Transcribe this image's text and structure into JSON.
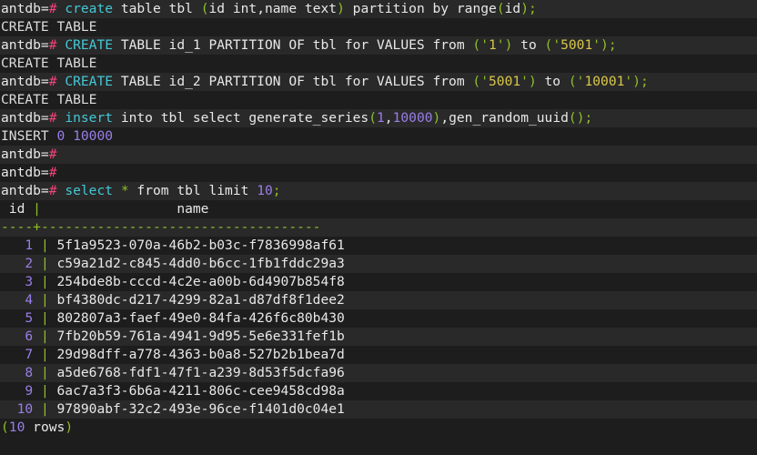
{
  "terminal": {
    "title": "antdb psql session",
    "prompt": "antdb=",
    "prompt_symbol": "#",
    "colors": {
      "background": "#1d1d1d",
      "background_alt": "#292929",
      "foreground": "#e8e8e8",
      "keyword": "#43c8d6",
      "punctuation": "#8fc029",
      "string": "#d9c84a",
      "number": "#9a7fe8",
      "prompt_hash": "#f0447a"
    },
    "lines": [
      {
        "id": "cmd-create-table",
        "type": "command",
        "text": "antdb=# create table tbl (id int,name text) partition by range(id);",
        "tokens": [
          {
            "t": "antdb=",
            "c": "c-prompt"
          },
          {
            "t": "#",
            "c": "c-hash"
          },
          {
            "t": " ",
            "c": "c-white"
          },
          {
            "t": "create",
            "c": "c-kw"
          },
          {
            "t": " table tbl ",
            "c": "c-white"
          },
          {
            "t": "(",
            "c": "c-punct"
          },
          {
            "t": "id int,name text",
            "c": "c-white"
          },
          {
            "t": ")",
            "c": "c-punct"
          },
          {
            "t": " partition by range",
            "c": "c-white"
          },
          {
            "t": "(",
            "c": "c-punct"
          },
          {
            "t": "id",
            "c": "c-white"
          },
          {
            "t": ")",
            "c": "c-punct"
          },
          {
            "t": ";",
            "c": "c-punct"
          }
        ]
      },
      {
        "id": "out-create-table-1",
        "type": "output",
        "text": "CREATE TABLE",
        "tokens": [
          {
            "t": "CREATE TABLE",
            "c": "c-out"
          }
        ]
      },
      {
        "id": "cmd-create-partition-id1",
        "type": "command",
        "text": "antdb=# CREATE TABLE id_1 PARTITION OF tbl for VALUES from ('1') to ('5001');",
        "tokens": [
          {
            "t": "antdb=",
            "c": "c-prompt"
          },
          {
            "t": "#",
            "c": "c-hash"
          },
          {
            "t": " ",
            "c": "c-white"
          },
          {
            "t": "CREATE",
            "c": "c-kw"
          },
          {
            "t": " TABLE id_1 PARTITION OF tbl for VALUES from ",
            "c": "c-white"
          },
          {
            "t": "('",
            "c": "c-punct"
          },
          {
            "t": "1",
            "c": "c-str"
          },
          {
            "t": "')",
            "c": "c-punct"
          },
          {
            "t": " to ",
            "c": "c-white"
          },
          {
            "t": "('",
            "c": "c-punct"
          },
          {
            "t": "5001",
            "c": "c-str"
          },
          {
            "t": "')",
            "c": "c-punct"
          },
          {
            "t": ";",
            "c": "c-punct"
          }
        ]
      },
      {
        "id": "out-create-table-2",
        "type": "output",
        "text": "CREATE TABLE",
        "tokens": [
          {
            "t": "CREATE TABLE",
            "c": "c-out"
          }
        ]
      },
      {
        "id": "cmd-create-partition-id2",
        "type": "command",
        "text": "antdb=# CREATE TABLE id_2 PARTITION OF tbl for VALUES from ('5001') to ('10001');",
        "tokens": [
          {
            "t": "antdb=",
            "c": "c-prompt"
          },
          {
            "t": "#",
            "c": "c-hash"
          },
          {
            "t": " ",
            "c": "c-white"
          },
          {
            "t": "CREATE",
            "c": "c-kw"
          },
          {
            "t": " TABLE id_2 PARTITION OF tbl for VALUES from ",
            "c": "c-white"
          },
          {
            "t": "('",
            "c": "c-punct"
          },
          {
            "t": "5001",
            "c": "c-str"
          },
          {
            "t": "')",
            "c": "c-punct"
          },
          {
            "t": " to ",
            "c": "c-white"
          },
          {
            "t": "('",
            "c": "c-punct"
          },
          {
            "t": "10001",
            "c": "c-str"
          },
          {
            "t": "')",
            "c": "c-punct"
          },
          {
            "t": ";",
            "c": "c-punct"
          }
        ]
      },
      {
        "id": "out-create-table-3",
        "type": "output",
        "text": "CREATE TABLE",
        "tokens": [
          {
            "t": "CREATE TABLE",
            "c": "c-out"
          }
        ]
      },
      {
        "id": "cmd-insert",
        "type": "command",
        "text": "antdb=# insert into tbl select generate_series(1,10000),gen_random_uuid();",
        "tokens": [
          {
            "t": "antdb=",
            "c": "c-prompt"
          },
          {
            "t": "#",
            "c": "c-hash"
          },
          {
            "t": " ",
            "c": "c-white"
          },
          {
            "t": "insert",
            "c": "c-kw"
          },
          {
            "t": " into tbl select generate_series",
            "c": "c-white"
          },
          {
            "t": "(",
            "c": "c-punct"
          },
          {
            "t": "1",
            "c": "c-num"
          },
          {
            "t": ",",
            "c": "c-white"
          },
          {
            "t": "10000",
            "c": "c-num"
          },
          {
            "t": ")",
            "c": "c-punct"
          },
          {
            "t": ",gen_random_uuid",
            "c": "c-white"
          },
          {
            "t": "()",
            "c": "c-punct"
          },
          {
            "t": ";",
            "c": "c-punct"
          }
        ]
      },
      {
        "id": "out-insert",
        "type": "output",
        "text": "INSERT 0 10000",
        "tokens": [
          {
            "t": "INSERT ",
            "c": "c-out"
          },
          {
            "t": "0",
            "c": "c-num"
          },
          {
            "t": " ",
            "c": "c-white"
          },
          {
            "t": "10000",
            "c": "c-num"
          }
        ]
      },
      {
        "id": "prompt-empty-1",
        "type": "command",
        "text": "antdb=#",
        "tokens": [
          {
            "t": "antdb=",
            "c": "c-prompt"
          },
          {
            "t": "#",
            "c": "c-hash"
          }
        ]
      },
      {
        "id": "prompt-empty-2",
        "type": "command",
        "text": "antdb=#",
        "tokens": [
          {
            "t": "antdb=",
            "c": "c-prompt"
          },
          {
            "t": "#",
            "c": "c-hash"
          }
        ]
      },
      {
        "id": "cmd-select",
        "type": "command",
        "text": "antdb=# select * from tbl limit 10;",
        "tokens": [
          {
            "t": "antdb=",
            "c": "c-prompt"
          },
          {
            "t": "#",
            "c": "c-hash"
          },
          {
            "t": " ",
            "c": "c-white"
          },
          {
            "t": "select",
            "c": "c-kw"
          },
          {
            "t": " ",
            "c": "c-white"
          },
          {
            "t": "*",
            "c": "c-punct"
          },
          {
            "t": " from tbl limit ",
            "c": "c-white"
          },
          {
            "t": "10",
            "c": "c-num"
          },
          {
            "t": ";",
            "c": "c-punct"
          }
        ]
      },
      {
        "id": "table-header",
        "type": "table-header",
        "text": " id |                 name",
        "tokens": [
          {
            "t": " id ",
            "c": "c-white"
          },
          {
            "t": "|",
            "c": "c-green"
          },
          {
            "t": "                 name",
            "c": "c-white"
          }
        ]
      },
      {
        "id": "table-separator",
        "type": "table-separator",
        "text": "----+-----------------------------------",
        "tokens": [
          {
            "t": "----",
            "c": "c-green"
          },
          {
            "t": "+",
            "c": "c-green"
          },
          {
            "t": "-----------------------------------",
            "c": "c-green"
          }
        ]
      }
    ],
    "table": {
      "columns": [
        "id",
        "name"
      ],
      "rows": [
        {
          "id": "1",
          "name": "5f1a9523-070a-46b2-b03c-f7836998af61"
        },
        {
          "id": "2",
          "name": "c59a21d2-c845-4dd0-b6cc-1fb1fddc29a3"
        },
        {
          "id": "3",
          "name": "254bde8b-cccd-4c2e-a00b-6d4907b854f8"
        },
        {
          "id": "4",
          "name": "bf4380dc-d217-4299-82a1-d87df8f1dee2"
        },
        {
          "id": "5",
          "name": "802807a3-faef-49e0-84fa-426f6c80b430"
        },
        {
          "id": "6",
          "name": "7fb20b59-761a-4941-9d95-5e6e331fef1b"
        },
        {
          "id": "7",
          "name": "29d98dff-a778-4363-b0a8-527b2b1bea7d"
        },
        {
          "id": "8",
          "name": "a5de6768-fdf1-47f1-a239-8d53f5dcfa96"
        },
        {
          "id": "9",
          "name": "6ac7a3f3-6b6a-4211-806c-cee9458cd98a"
        },
        {
          "id": "10",
          "name": "97890abf-32c2-493e-96ce-f1401d0c04e1"
        }
      ],
      "row_count_label": "(10 rows)",
      "row_count_value": "10",
      "row_count_word": "rows"
    }
  }
}
